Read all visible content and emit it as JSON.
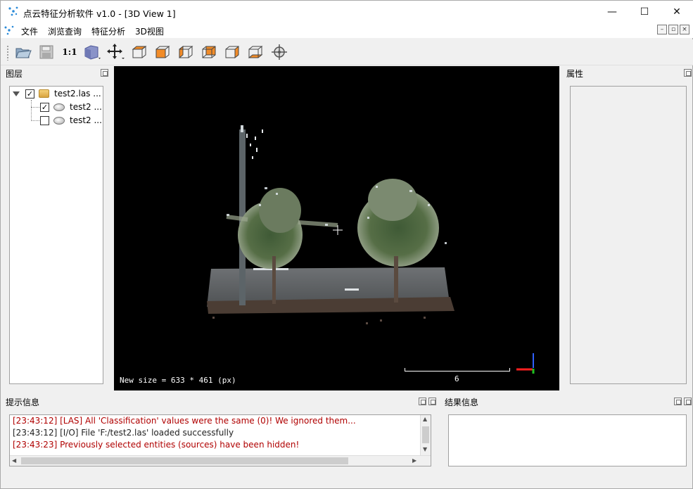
{
  "window": {
    "title": "点云特征分析软件 v1.0 - [3D View 1]",
    "minimize": "—",
    "maximize": "☐",
    "close": "✕"
  },
  "menu": {
    "items": [
      "文件",
      "浏览查询",
      "特征分析",
      "3D视图"
    ],
    "mdi_buttons": [
      "–",
      "▫",
      "×"
    ]
  },
  "toolbar": {
    "zoom_label": "1:1",
    "icons": [
      "open-folder-icon",
      "save-icon",
      "zoom-1-1-icon",
      "perspective-cube-icon",
      "pivot-crosshair-icon",
      "view-top-icon",
      "view-front-icon",
      "view-left-icon",
      "view-back-icon",
      "view-right-icon",
      "view-bottom-icon",
      "point-picking-icon"
    ]
  },
  "layers_panel": {
    "title": "图层",
    "tree": [
      {
        "label": "test2.las ...",
        "checked": true,
        "type": "folder"
      },
      {
        "label": "test2 ...",
        "checked": true,
        "type": "cloud"
      },
      {
        "label": "test2 ...",
        "checked": false,
        "type": "cloud"
      }
    ]
  },
  "properties_panel": {
    "title": "属性"
  },
  "view": {
    "status": "New size = 633 * 461 (px)",
    "scale_value": "6"
  },
  "console_panel": {
    "title": "提示信息",
    "lines": [
      {
        "text": "[23:43:12] [LAS] All 'Classification' values were the same (0)! We ignored them...",
        "level": "error"
      },
      {
        "text": "[23:43:12] [I/O] File 'F:/test2.las' loaded successfully",
        "level": "info"
      },
      {
        "text": "[23:43:23] Previously selected entities (sources) have been hidden!",
        "level": "error"
      }
    ]
  },
  "result_panel": {
    "title": "结果信息"
  },
  "colors": {
    "error_text": "#b00000",
    "axis_x": "#ff2020",
    "axis_y": "#20c020",
    "axis_z": "#3060ff"
  }
}
